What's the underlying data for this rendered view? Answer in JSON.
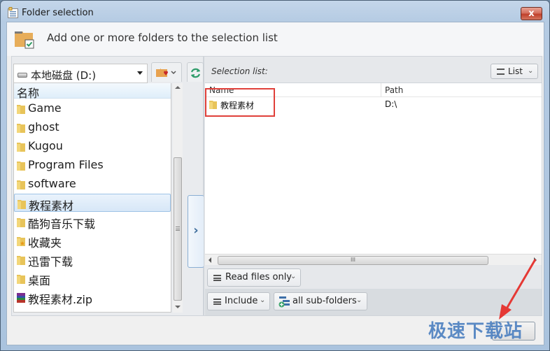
{
  "window": {
    "title": "Folder selection",
    "close_label": "x"
  },
  "header": {
    "text": "Add one or more folders to the selection list"
  },
  "browser": {
    "drive_label": "本地磁盘 (D:)",
    "column_header": "名称",
    "items": [
      {
        "label": "Game",
        "icon": "folder-icon"
      },
      {
        "label": "ghost",
        "icon": "folder-icon"
      },
      {
        "label": "Kugou",
        "icon": "folder-icon"
      },
      {
        "label": "Program Files",
        "icon": "folder-icon"
      },
      {
        "label": "software",
        "icon": "folder-icon"
      },
      {
        "label": "教程素材",
        "icon": "folder-icon",
        "selected": true
      },
      {
        "label": "酷狗音乐下载",
        "icon": "folder-icon"
      },
      {
        "label": "收藏夹",
        "icon": "favorites-folder-icon"
      },
      {
        "label": "迅雷下载",
        "icon": "folder-icon"
      },
      {
        "label": "桌面",
        "icon": "folder-icon"
      },
      {
        "label": "教程素材.zip",
        "icon": "archive-icon"
      }
    ],
    "add_button_glyph": "›"
  },
  "selection": {
    "label": "Selection list:",
    "view_button": "List",
    "columns": {
      "name": "Name",
      "path": "Path"
    },
    "rows": [
      {
        "name": "教程素材",
        "path": "D:\\"
      }
    ],
    "scroll_grip": "III"
  },
  "options": {
    "read_mode": "Read files only",
    "include_mode": "Include",
    "subfolders": "all sub-folders"
  },
  "watermark": "极速下载站",
  "colors": {
    "highlight": "#e0403a",
    "accent": "#3f6e9c",
    "refresh": "#2e9c6a"
  }
}
